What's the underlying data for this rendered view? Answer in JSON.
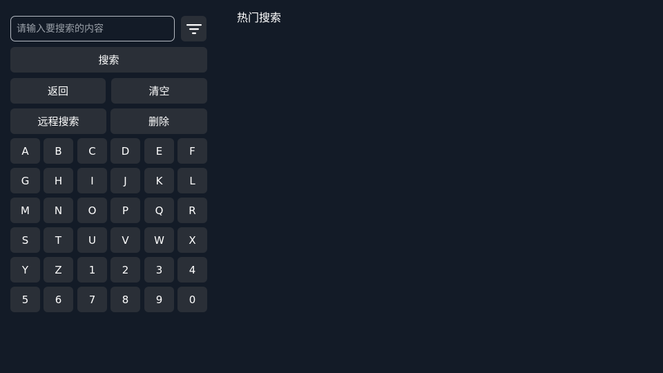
{
  "search": {
    "placeholder": "请输入要搜索的内容",
    "value": "",
    "filter_icon": "filter-icon"
  },
  "actions": {
    "search_label": "搜索",
    "back_label": "返回",
    "clear_label": "清空",
    "remote_search_label": "远程搜索",
    "delete_label": "删除"
  },
  "keyboard": {
    "keys": [
      "A",
      "B",
      "C",
      "D",
      "E",
      "F",
      "G",
      "H",
      "I",
      "J",
      "K",
      "L",
      "M",
      "N",
      "O",
      "P",
      "Q",
      "R",
      "S",
      "T",
      "U",
      "V",
      "W",
      "X",
      "Y",
      "Z",
      "1",
      "2",
      "3",
      "4",
      "5",
      "6",
      "7",
      "8",
      "9",
      "0"
    ]
  },
  "hot_search": {
    "title": "热门搜索"
  },
  "colors": {
    "background": "#131b27",
    "button": "#2a2f37",
    "text": "#ffffff"
  }
}
